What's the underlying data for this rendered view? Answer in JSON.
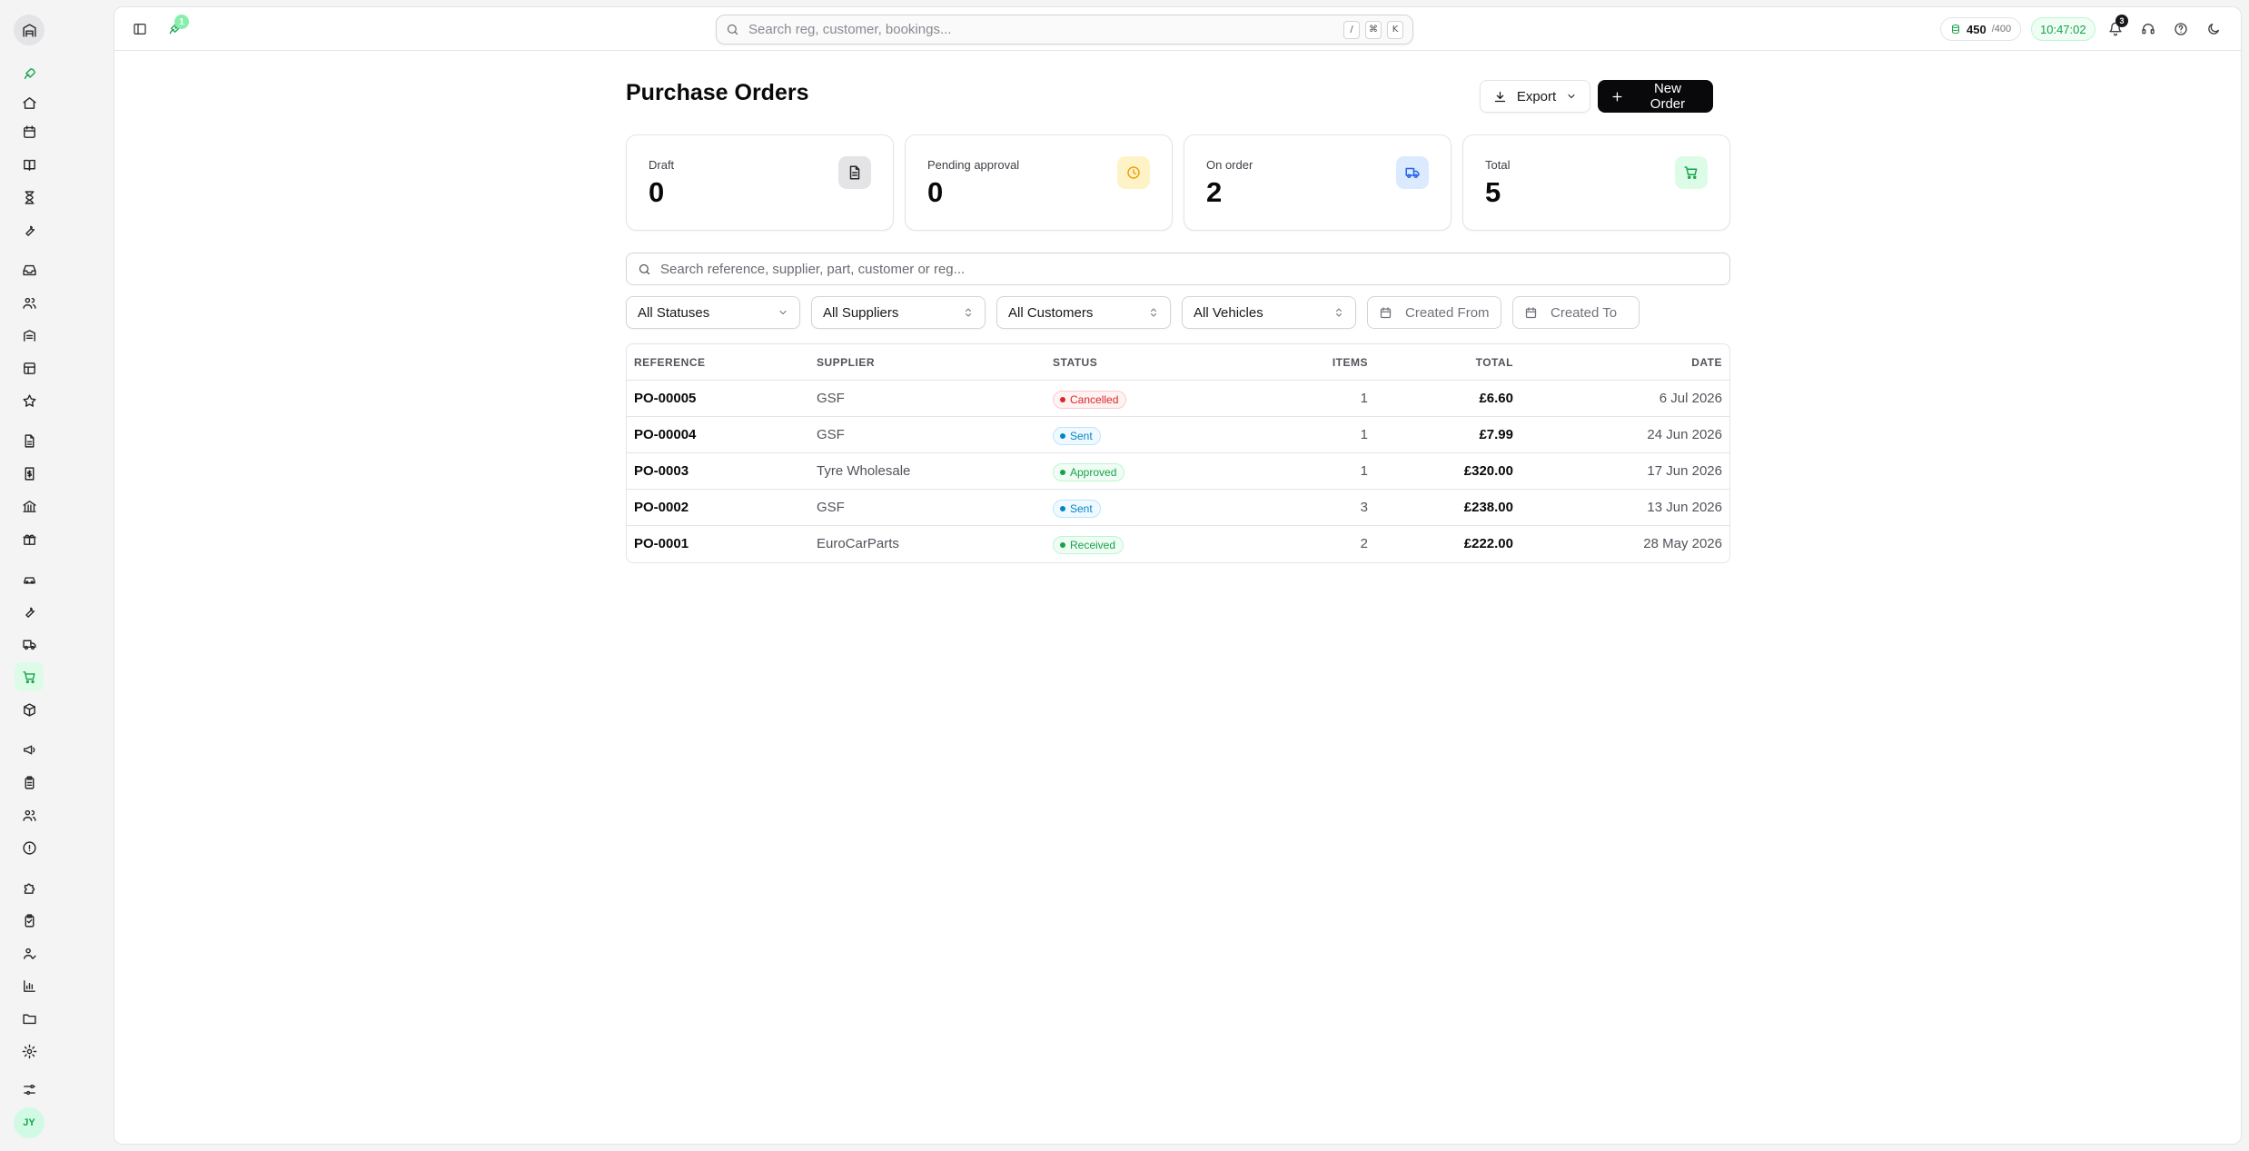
{
  "topbar": {
    "notification_count_left": "1",
    "search_placeholder": "Search reg, customer, bookings...",
    "shortcut_keys": [
      "/",
      "⌘",
      "K"
    ],
    "credits_used": "450",
    "credits_max": "/400",
    "clock": "10:47:02",
    "bell_count": "3"
  },
  "sidebar": {
    "avatar_initials": "JY",
    "icons": [
      "rocket-icon",
      "home-icon",
      "calendar-icon",
      "book-icon",
      "hourglass-icon",
      "wrench-icon",
      "inbox-icon",
      "users-icon",
      "building-icon",
      "table-icon",
      "star-icon",
      "document-icon",
      "invoice-icon",
      "bank-icon",
      "gift-icon",
      "car-icon",
      "tools-icon",
      "truck-icon",
      "cart-icon",
      "package-icon",
      "megaphone-icon",
      "clipboard-icon",
      "team-icon",
      "info-icon",
      "puzzle-icon",
      "checklist-icon",
      "user-check-icon",
      "chart-icon",
      "folder-icon",
      "settings-icon",
      "sliders-icon"
    ]
  },
  "page": {
    "title": "Purchase Orders",
    "export_label": "Export",
    "new_order_label": "New Order"
  },
  "stats": [
    {
      "label": "Draft",
      "value": "0",
      "icon": "document-icon",
      "bg": "#e4e4e7",
      "fg": "#27272a"
    },
    {
      "label": "Pending approval",
      "value": "0",
      "icon": "clock-icon",
      "bg": "#fef3c7",
      "fg": "#f59e0b"
    },
    {
      "label": "On order",
      "value": "2",
      "icon": "truck-icon",
      "bg": "#dbeafe",
      "fg": "#2563eb"
    },
    {
      "label": "Total",
      "value": "5",
      "icon": "cart-icon",
      "bg": "#dcfce7",
      "fg": "#16a34a"
    }
  ],
  "filters": {
    "search_placeholder": "Search reference, supplier, part, customer or reg...",
    "status": "All Statuses",
    "supplier": "All Suppliers",
    "customer": "All Customers",
    "vehicle": "All Vehicles",
    "created_from": "Created From",
    "created_to": "Created To"
  },
  "table": {
    "headers": {
      "reference": "REFERENCE",
      "supplier": "SUPPLIER",
      "status": "STATUS",
      "items": "ITEMS",
      "total": "TOTAL",
      "date": "DATE"
    },
    "rows": [
      {
        "reference": "PO-00005",
        "supplier": "GSF",
        "status": "Cancelled",
        "items": "1",
        "total": "£6.60",
        "date": "6 Jul 2026"
      },
      {
        "reference": "PO-00004",
        "supplier": "GSF",
        "status": "Sent",
        "items": "1",
        "total": "£7.99",
        "date": "24 Jun 2026"
      },
      {
        "reference": "PO-0003",
        "supplier": "Tyre Wholesale",
        "status": "Approved",
        "items": "1",
        "total": "£320.00",
        "date": "17 Jun 2026"
      },
      {
        "reference": "PO-0002",
        "supplier": "GSF",
        "status": "Sent",
        "items": "3",
        "total": "£238.00",
        "date": "13 Jun 2026"
      },
      {
        "reference": "PO-0001",
        "supplier": "EuroCarParts",
        "status": "Received",
        "items": "2",
        "total": "£222.00",
        "date": "28 May 2026"
      }
    ]
  },
  "status_colors": {
    "Cancelled": {
      "fg": "#dc2626",
      "bg": "#fef2f2",
      "border": "#fecaca"
    },
    "Sent": {
      "fg": "#0284c7",
      "bg": "#f0f9ff",
      "border": "#bae6fd"
    },
    "Approved": {
      "fg": "#16a34a",
      "bg": "#f0fdf4",
      "border": "#bbf7d0"
    },
    "Received": {
      "fg": "#16a34a",
      "bg": "#f0fdf4",
      "border": "#bbf7d0"
    }
  }
}
